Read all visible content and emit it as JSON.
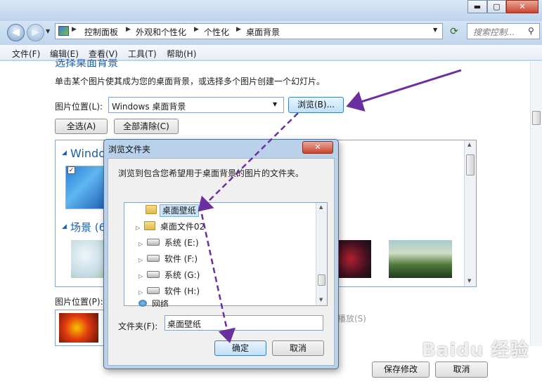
{
  "window": {
    "min": "▬",
    "max": "▢",
    "close": "✕"
  },
  "nav": {
    "crumbs": [
      "控制面板",
      "外观和个性化",
      "个性化",
      "桌面背景"
    ],
    "search_placeholder": "搜索控制...",
    "search_icon": "search-icon"
  },
  "menu": [
    "文件(F)",
    "编辑(E)",
    "查看(V)",
    "工具(T)",
    "帮助(H)"
  ],
  "main": {
    "heading": "选择桌面背景",
    "description": "单击某个图片使其成为您的桌面背景，或选择多个图片创建一个幻灯片。",
    "location_label": "图片位置(L):",
    "location_value": "Windows 桌面背景",
    "browse_label": "浏览(B)...",
    "select_all": "全选(A)",
    "clear_all": "全部清除(C)",
    "group1": "Windo",
    "group2": "场景 (6",
    "position_label": "图片位置(P):",
    "slideshow_fragment": "播放(S)",
    "save": "保存修改",
    "cancel": "取消"
  },
  "dialog": {
    "title": "浏览文件夹",
    "close": "✕",
    "instruction": "浏览到包含您希望用于桌面背景的图片的文件夹。",
    "tree": [
      {
        "label": "桌面壁纸",
        "kind": "folder",
        "level": 2,
        "selected": true
      },
      {
        "label": "桌面文件02",
        "kind": "folder",
        "level": 2,
        "selected": false
      },
      {
        "label": "系统 (E:)",
        "kind": "drive",
        "level": 1,
        "selected": false
      },
      {
        "label": "软件 (F:)",
        "kind": "drive",
        "level": 1,
        "selected": false
      },
      {
        "label": "系统 (G:)",
        "kind": "drive",
        "level": 1,
        "selected": false
      },
      {
        "label": "软件 (H:)",
        "kind": "drive",
        "level": 1,
        "selected": false
      },
      {
        "label": "网络",
        "kind": "network",
        "level": 0,
        "selected": false
      }
    ],
    "folder_label": "文件夹(F):",
    "folder_value": "桌面壁纸",
    "ok": "确定",
    "cancel": "取消"
  },
  "watermark": "Baidu 经验",
  "colors": {
    "accent": "#6b2fa0",
    "heading": "#1f5fa8"
  }
}
